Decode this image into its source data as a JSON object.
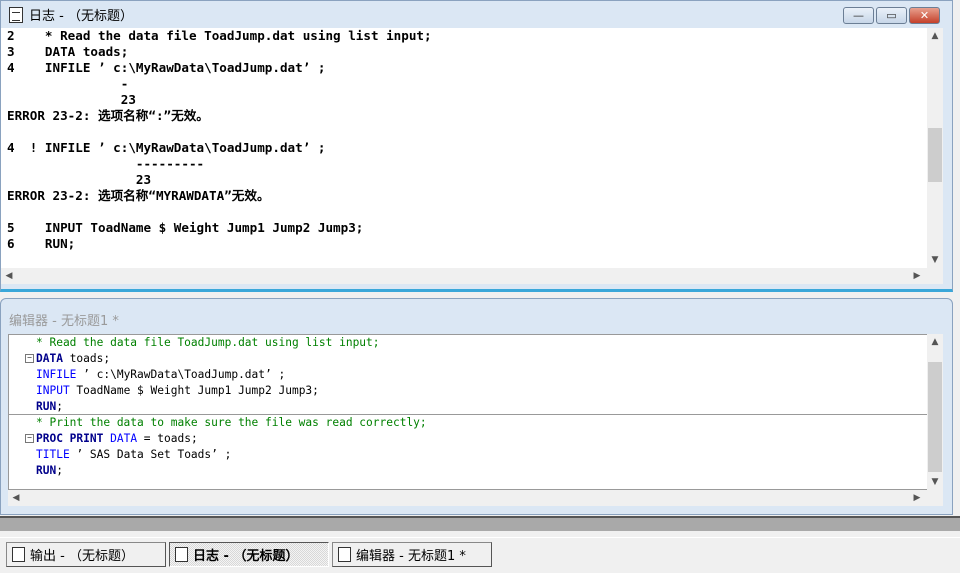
{
  "log_window": {
    "title": "日志 - （无标题）",
    "buttons": {
      "minimize": "—",
      "maximize": "▭",
      "close": "✕"
    },
    "lines": [
      {
        "text": "2    * Read the data file ToadJump.dat using list input;",
        "type": "normal"
      },
      {
        "text": "3    DATA toads;",
        "type": "normal"
      },
      {
        "text": "4    INFILE ’ c:\\MyRawData\\ToadJump.dat’ ;",
        "type": "normal"
      },
      {
        "text": "               -",
        "type": "err"
      },
      {
        "text": "               23",
        "type": "err"
      },
      {
        "text": "ERROR 23-2: 选项名称“:”无效。",
        "type": "err"
      },
      {
        "text": "",
        "type": "normal"
      },
      {
        "text": "4  ! INFILE ’ c:\\MyRawData\\ToadJump.dat’ ;",
        "type": "normal"
      },
      {
        "text": "                 ---------",
        "type": "err"
      },
      {
        "text": "                 23",
        "type": "err"
      },
      {
        "text": "ERROR 23-2: 选项名称“MYRAWDATA”无效。",
        "type": "err"
      },
      {
        "text": "",
        "type": "normal"
      },
      {
        "text": "5    INPUT ToadName $ Weight Jump1 Jump2 Jump3;",
        "type": "normal"
      },
      {
        "text": "6    RUN;",
        "type": "normal"
      }
    ]
  },
  "editor_window": {
    "title": "编辑器 - 无标题1 *",
    "lines": [
      {
        "fold": false,
        "sep": false,
        "segs": [
          [
            "cm",
            "* Read the data file ToadJump.dat using list input;"
          ]
        ]
      },
      {
        "fold": true,
        "sep": false,
        "segs": [
          [
            "kw",
            "DATA"
          ],
          [
            "tx",
            " toads;"
          ]
        ]
      },
      {
        "fold": false,
        "sep": false,
        "segs": [
          [
            "bl",
            "INFILE"
          ],
          [
            "tx",
            " ’ c:\\MyRawData\\ToadJump.dat’ ;"
          ]
        ]
      },
      {
        "fold": false,
        "sep": false,
        "segs": [
          [
            "bl",
            "INPUT"
          ],
          [
            "tx",
            " ToadName $ Weight Jump1 Jump2 Jump3;"
          ]
        ]
      },
      {
        "fold": false,
        "sep": true,
        "segs": [
          [
            "kw",
            "RUN"
          ],
          [
            "tx",
            ";"
          ]
        ]
      },
      {
        "fold": false,
        "sep": false,
        "segs": [
          [
            "cm",
            "* Print the data to make sure the file was read correctly;"
          ]
        ]
      },
      {
        "fold": true,
        "sep": false,
        "segs": [
          [
            "kw",
            "PROC PRINT"
          ],
          [
            "tx",
            " "
          ],
          [
            "bl",
            "DATA"
          ],
          [
            "tx",
            " = toads;"
          ]
        ]
      },
      {
        "fold": false,
        "sep": false,
        "segs": [
          [
            "bl",
            "TITLE"
          ],
          [
            "tx",
            " ’ SAS Data Set Toads’ ;"
          ]
        ]
      },
      {
        "fold": false,
        "sep": false,
        "segs": [
          [
            "kw",
            "RUN"
          ],
          [
            "tx",
            ";"
          ]
        ]
      }
    ]
  },
  "taskbar": {
    "items": [
      {
        "label": "输出 - （无标题）",
        "active": false
      },
      {
        "label": "日志 - （无标题）",
        "active": true
      },
      {
        "label": "编辑器 - 无标题1 *",
        "active": false
      }
    ]
  }
}
